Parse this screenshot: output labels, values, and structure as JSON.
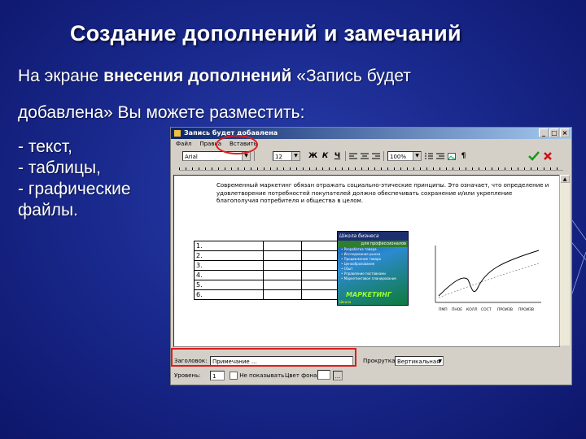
{
  "slide": {
    "title": "Создание дополнений и замечаний",
    "line1_a": "На экране ",
    "line1_b": "внесения дополнений",
    "line1_c": " «Запись будет",
    "line2": "добавлена» Вы можете разместить:",
    "bullets": [
      "- текст,",
      "- таблицы,",
      "- графические",
      "файлы."
    ]
  },
  "window": {
    "title": "Запись будет добавлена",
    "controls": [
      "_",
      "□",
      "×"
    ],
    "menu": [
      "Файл",
      "Правка",
      "Вставить"
    ],
    "font_name": "Arial",
    "font_size": "12",
    "zoom": "100%",
    "format_buttons": [
      "Ж",
      "К",
      "Ч"
    ],
    "para_mark": "¶",
    "doc_text": "Современный маркетинг обязан отражать социально-этические принципы. Это означает, что определение и удовлетворение потребностей покупателей должно обеспечивать сохранение и/или укрепление благополучия потребителя и общества в целом.",
    "table_rows": [
      "1.",
      "2.",
      "3.",
      "4.",
      "5.",
      "6."
    ],
    "book": {
      "header": "Школа бизнеса",
      "subheader": "для профессионалов",
      "items": [
        "• Разработка товара",
        "• Исследование рынка",
        "• Продвижение товара",
        "• Ценообразование",
        "• Сбыт",
        "• Управление поставками",
        "• Маркетинговое планирование"
      ],
      "brand": "МАРКЕТИНГ",
      "footer": "Школа"
    },
    "graph_labels": [
      "ПМП",
      "ПНОЕ",
      "КОЛЛ",
      "СОСТ",
      "ПРОИЗВ",
      "ПРОИЗВ"
    ],
    "heading_label": "Заголовок:",
    "heading_value": "Примечание ...",
    "scroll_label": "Прокрутка:",
    "scroll_value": "Вертикальная",
    "level_label": "Уровень:",
    "level_value": "1",
    "hide_label": "Не показывать",
    "bg_label": "Цвет фона:",
    "bg_button": "..."
  },
  "colors": {
    "slide_bg": "#1a2a8f",
    "highlight": "#e01b1b",
    "titlebar": "#0a246a"
  }
}
